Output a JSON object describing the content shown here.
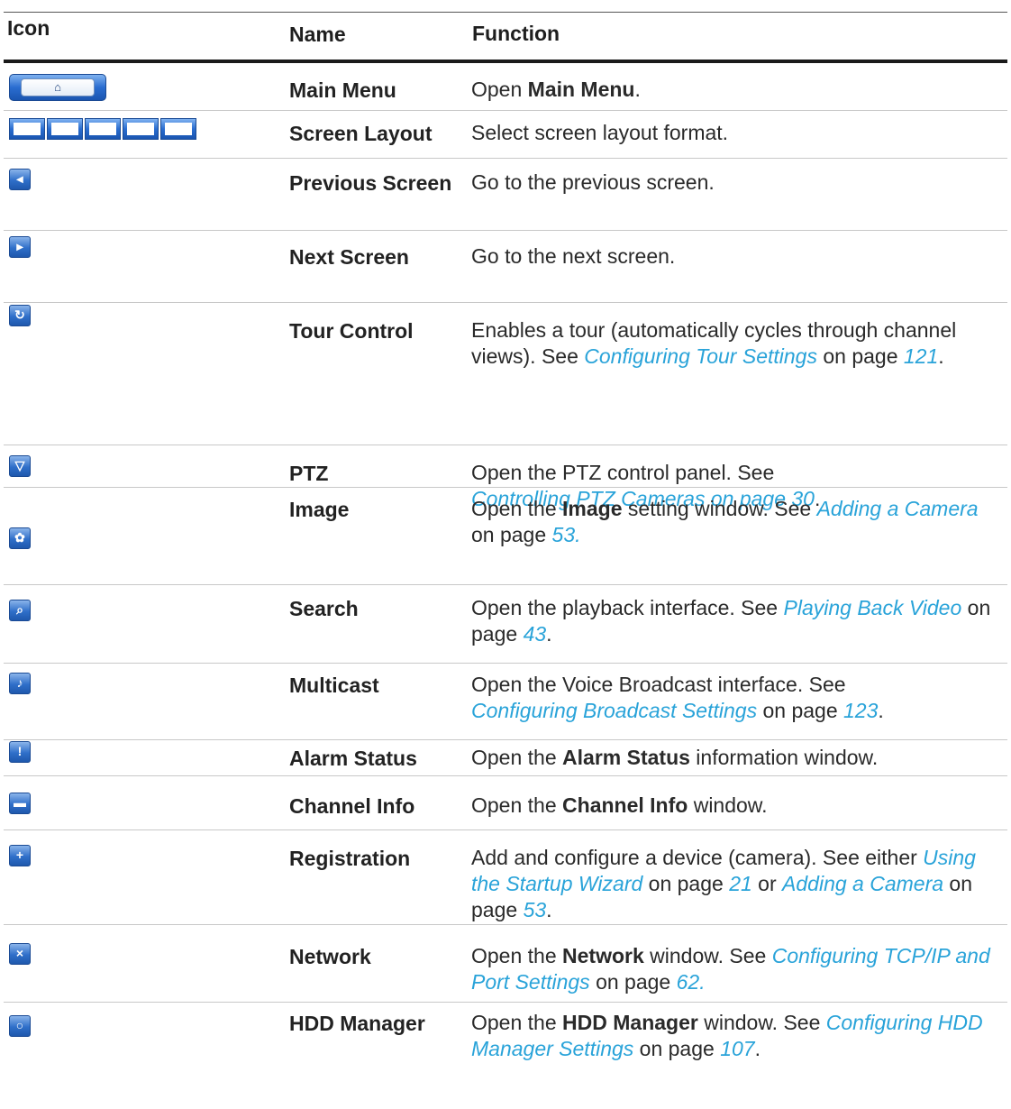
{
  "header": {
    "icon": "Icon",
    "name": "Name",
    "function": "Function"
  },
  "rows": [
    {
      "name": "Main Menu",
      "icon": "home-icon",
      "function": [
        {
          "t": "Open "
        },
        {
          "t": "Main Menu",
          "b": true
        },
        {
          "t": "."
        }
      ]
    },
    {
      "name": "Screen Layout",
      "icon": "screen-layout-icons",
      "function": [
        {
          "t": "Select screen layout format."
        }
      ]
    },
    {
      "name": "Previous Screen",
      "icon": "previous-screen-icon",
      "function": [
        {
          "t": "Go to the previous screen."
        }
      ]
    },
    {
      "name": "Next Screen",
      "icon": "next-screen-icon",
      "function": [
        {
          "t": "Go to the next screen."
        }
      ]
    },
    {
      "name": "Tour Control",
      "icon": "tour-control-icon",
      "function": [
        {
          "t": "Enables a tour (automatically cycles through channel views). See "
        },
        {
          "t": "Configuring Tour Settings",
          "l": true
        },
        {
          "t": " on page "
        },
        {
          "t": "121",
          "l": true
        },
        {
          "t": "."
        }
      ]
    },
    {
      "name": "PTZ",
      "icon": "ptz-dome-icon",
      "function": [
        {
          "t": "Open the PTZ control panel. See "
        },
        {
          "br": true
        },
        {
          "t": "Controlling PTZ Cameras on page 30",
          "l": true
        },
        {
          "t": "."
        }
      ]
    },
    {
      "name": "Image",
      "icon": "image-palette-icon",
      "function": [
        {
          "t": "Open the "
        },
        {
          "t": "Image",
          "b": true
        },
        {
          "t": " setting window. See "
        },
        {
          "t": "Adding a Camera",
          "l": true
        },
        {
          "br": true
        },
        {
          "t": "on page "
        },
        {
          "t": "53.",
          "l": true
        }
      ]
    },
    {
      "name": "Search",
      "icon": "search-icon",
      "function": [
        {
          "t": "Open the playback interface. See "
        },
        {
          "t": "Playing Back Video",
          "l": true
        },
        {
          "t": " on page "
        },
        {
          "t": "43",
          "l": true
        },
        {
          "t": "."
        }
      ]
    },
    {
      "name": "Multicast",
      "icon": "multicast-icon",
      "function": [
        {
          "t": "Open the Voice Broadcast interface. See "
        },
        {
          "br": true
        },
        {
          "t": "Configuring Broadcast Settings",
          "l": true
        },
        {
          "t": " on page "
        },
        {
          "t": "123",
          "l": true
        },
        {
          "t": "."
        }
      ]
    },
    {
      "name": "Alarm Status",
      "icon": "alarm-warning-icon",
      "function": [
        {
          "t": "Open the "
        },
        {
          "t": "Alarm Status",
          "b": true
        },
        {
          "t": " information window."
        }
      ]
    },
    {
      "name": "Channel Info",
      "icon": "camera-info-icon",
      "function": [
        {
          "t": "Open the "
        },
        {
          "t": "Channel Info",
          "b": true
        },
        {
          "t": " window."
        }
      ]
    },
    {
      "name": "Registration",
      "icon": "camera-add-icon",
      "function": [
        {
          "t": "Add and configure a device (camera). See either "
        },
        {
          "t": "Using the Startup Wizard",
          "l": true
        },
        {
          "t": " on page "
        },
        {
          "t": "21",
          "l": true
        },
        {
          "t": " or "
        },
        {
          "t": "Adding a Camera",
          "l": true
        },
        {
          "t": " on page "
        },
        {
          "t": "53",
          "l": true
        },
        {
          "t": "."
        }
      ]
    },
    {
      "name": "Network",
      "icon": "network-error-icon",
      "function": [
        {
          "t": "Open the "
        },
        {
          "t": "Network",
          "b": true
        },
        {
          "t": " window. See "
        },
        {
          "t": "Configuring TCP/IP and Port Settings",
          "l": true
        },
        {
          "t": " on page "
        },
        {
          "t": "62.",
          "l": true
        }
      ]
    },
    {
      "name": "HDD Manager",
      "icon": "hdd-icon",
      "function": [
        {
          "t": "Open the "
        },
        {
          "t": "HDD Manager",
          "b": true
        },
        {
          "t": " window. See "
        },
        {
          "t": "Configuring HDD Manager Settings",
          "l": true
        },
        {
          "t": " on page "
        },
        {
          "t": "107",
          "l": true
        },
        {
          "t": "."
        }
      ]
    }
  ]
}
